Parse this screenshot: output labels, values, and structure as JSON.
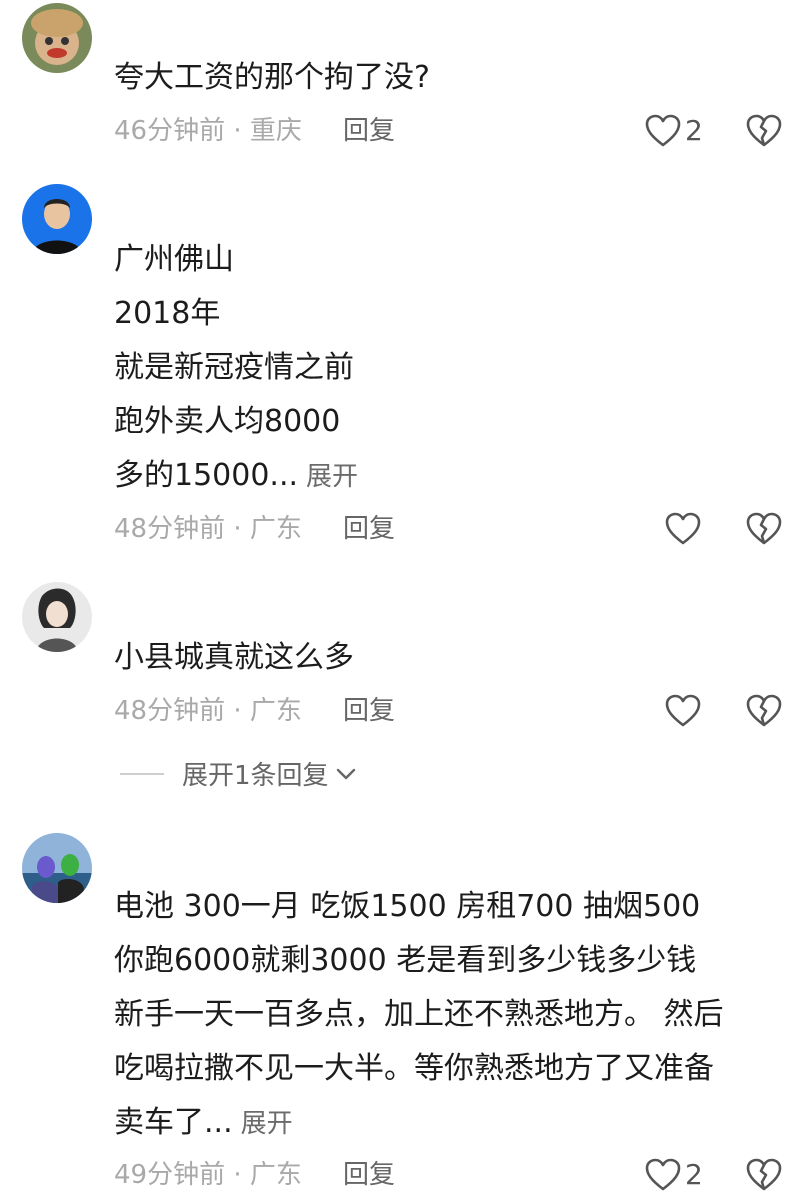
{
  "comments": [
    {
      "lines": [
        "夸大工资的那个拘了没?"
      ],
      "time": "46分钟前 · 重庆",
      "reply": "回复",
      "likes": "2"
    },
    {
      "lines": [
        "广州佛山",
        "2018年",
        "就是新冠疫情之前",
        "跑外卖人均8000",
        "多的15000..."
      ],
      "expand": "展开",
      "time": "48分钟前 · 广东",
      "reply": "回复",
      "likes": ""
    },
    {
      "lines": [
        "小县城真就这么多"
      ],
      "time": "48分钟前 · 广东",
      "reply": "回复",
      "likes": "",
      "expand_replies": "展开1条回复"
    },
    {
      "lines": [
        "电池 300一月  吃饭1500  房租700   抽烟500",
        "你跑6000就剩3000   老是看到多少钱多少钱",
        "新手一天一百多点，加上还不熟悉地方。 然后",
        "吃喝拉撒不见一大半。等你熟悉地方了又准备",
        "卖车了..."
      ],
      "expand": "展开",
      "time": "49分钟前 · 广东",
      "reply": "回复",
      "likes": "2"
    }
  ],
  "colors": {
    "text": "#1c1c1c",
    "meta": "#a9a9a9",
    "icon": "#555555"
  }
}
